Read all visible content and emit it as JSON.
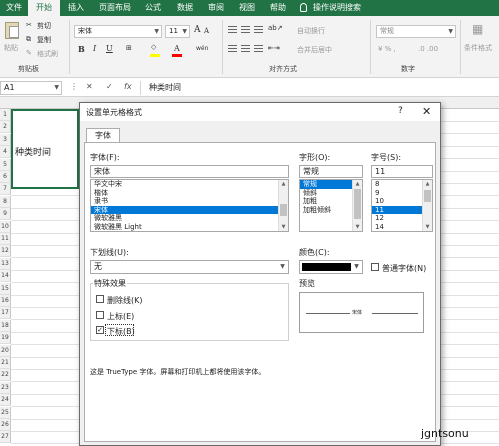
{
  "ribbon_tabs": [
    {
      "label": "文件",
      "active": false
    },
    {
      "label": "开始",
      "active": true
    },
    {
      "label": "插入",
      "active": false
    },
    {
      "label": "页面布局",
      "active": false
    },
    {
      "label": "公式",
      "active": false
    },
    {
      "label": "数据",
      "active": false
    },
    {
      "label": "审阅",
      "active": false
    },
    {
      "label": "视图",
      "active": false
    },
    {
      "label": "帮助",
      "active": false
    },
    {
      "label": "操作说明搜索",
      "active": false,
      "icon": "lightbulb-icon"
    }
  ],
  "ribbon": {
    "clipboard": {
      "cut": "剪切",
      "copy": "复制",
      "format_painter": "格式刷",
      "paste": "粘贴",
      "group": "剪贴板"
    },
    "font": {
      "name": "宋体",
      "size": "11",
      "bold": "B",
      "italic": "I",
      "underline": "U",
      "grow": "A",
      "shrink": "A",
      "font_color": "A",
      "phonetic": "wén",
      "highlight_color": "#ffff00",
      "text_color": "#ff0000"
    },
    "alignment": {
      "wrap": "自动换行",
      "merge": "合并后居中",
      "group": "对齐方式"
    },
    "number": {
      "format": "常规",
      "group": "数字"
    },
    "styles": {
      "conditional": "条件格式"
    }
  },
  "formula_bar": {
    "name_box": "A1",
    "cancel": "✕",
    "confirm": "✓",
    "fx": "fx",
    "content": "种类时间"
  },
  "sheet": {
    "a1_text": "种类时间",
    "rows": [
      "1",
      "2",
      "3",
      "4",
      "5",
      "6",
      "7",
      "8",
      "9",
      "10",
      "11",
      "12",
      "13",
      "14",
      "15",
      "16",
      "17",
      "18",
      "19",
      "20",
      "21",
      "22",
      "23",
      "24",
      "25",
      "26",
      "27"
    ]
  },
  "dialog": {
    "title": "设置单元格格式",
    "help": "?",
    "close": "✕",
    "tab": "字体",
    "font_label": "字体(F):",
    "font_value": "宋体",
    "font_list": [
      "华文中宋",
      "楷体",
      "隶书",
      "宋体",
      "微软雅黑",
      "微软雅黑 Light"
    ],
    "font_selected_index": 3,
    "style_label": "字形(O):",
    "style_value": "常规",
    "style_list": [
      "常规",
      "倾斜",
      "加粗",
      "加粗倾斜"
    ],
    "style_selected_index": 0,
    "size_label": "字号(S):",
    "size_value": "11",
    "size_list": [
      "8",
      "9",
      "10",
      "11",
      "12",
      "14"
    ],
    "size_selected_index": 3,
    "underline_label": "下划线(U):",
    "underline_value": "无",
    "color_label": "颜色(C):",
    "color_value": "#000000",
    "normal_font_label": "普通字体(N)",
    "effects_label": "特殊效果",
    "strikethrough_label": "删除线(K)",
    "superscript_label": "上标(E)",
    "subscript_label": "下标(B)",
    "subscript_checked": "✓",
    "preview_label": "预览",
    "preview_text": "宋体",
    "note": "这是 TrueType 字体。屏幕和打印机上都将使用该字体。"
  },
  "watermark": "jgntsonu"
}
